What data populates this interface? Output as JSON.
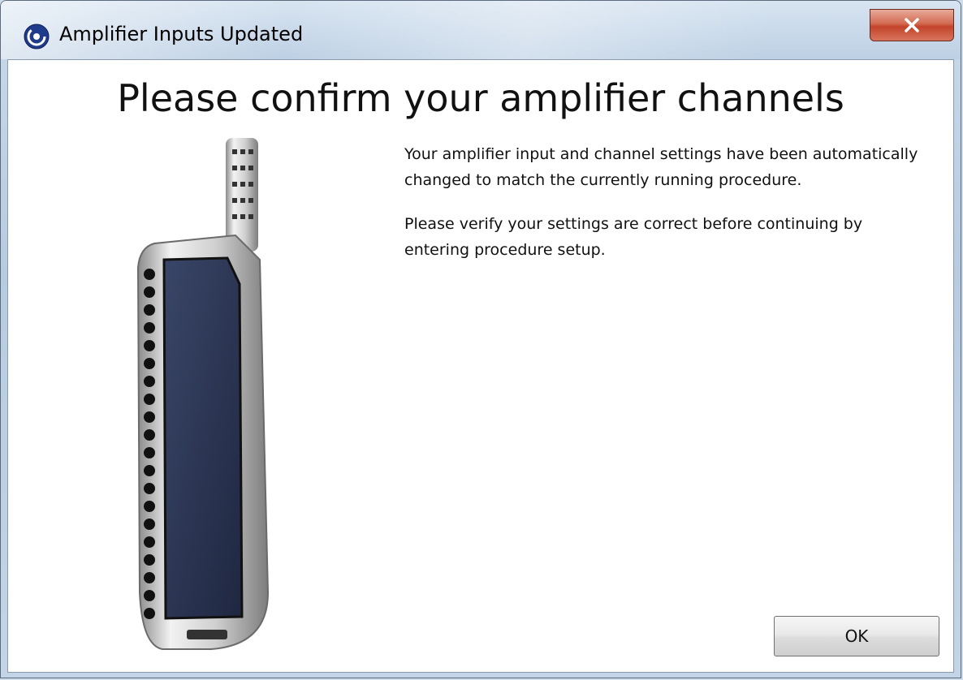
{
  "window": {
    "title": "Amplifier Inputs Updated",
    "app_icon": "app-logo-icon",
    "close_icon": "close-icon"
  },
  "dialog": {
    "heading": "Please confirm your amplifier channels",
    "paragraph_1": "Your amplifier input and channel settings have been automatically changed to match the currently running procedure.",
    "paragraph_2": "Please verify your settings are correct before continuing by entering procedure setup.",
    "illustration": "amplifier-device-icon",
    "ok_label": "OK"
  },
  "colors": {
    "close_button": "#c9452c",
    "device_screen": "#2b3553",
    "window_frame": "#bcd0e4"
  }
}
